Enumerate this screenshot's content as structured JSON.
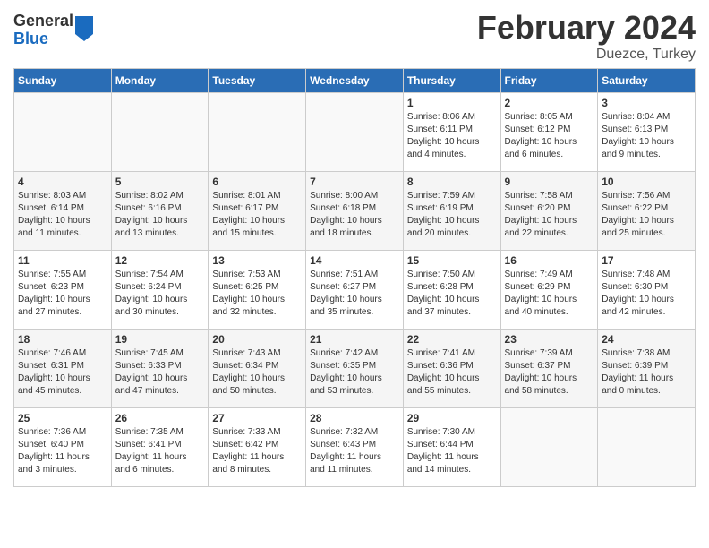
{
  "header": {
    "logo_general": "General",
    "logo_blue": "Blue",
    "month_title": "February 2024",
    "location": "Duezce, Turkey"
  },
  "weekdays": [
    "Sunday",
    "Monday",
    "Tuesday",
    "Wednesday",
    "Thursday",
    "Friday",
    "Saturday"
  ],
  "weeks": [
    [
      {
        "num": "",
        "info": ""
      },
      {
        "num": "",
        "info": ""
      },
      {
        "num": "",
        "info": ""
      },
      {
        "num": "",
        "info": ""
      },
      {
        "num": "1",
        "info": "Sunrise: 8:06 AM\nSunset: 6:11 PM\nDaylight: 10 hours\nand 4 minutes."
      },
      {
        "num": "2",
        "info": "Sunrise: 8:05 AM\nSunset: 6:12 PM\nDaylight: 10 hours\nand 6 minutes."
      },
      {
        "num": "3",
        "info": "Sunrise: 8:04 AM\nSunset: 6:13 PM\nDaylight: 10 hours\nand 9 minutes."
      }
    ],
    [
      {
        "num": "4",
        "info": "Sunrise: 8:03 AM\nSunset: 6:14 PM\nDaylight: 10 hours\nand 11 minutes."
      },
      {
        "num": "5",
        "info": "Sunrise: 8:02 AM\nSunset: 6:16 PM\nDaylight: 10 hours\nand 13 minutes."
      },
      {
        "num": "6",
        "info": "Sunrise: 8:01 AM\nSunset: 6:17 PM\nDaylight: 10 hours\nand 15 minutes."
      },
      {
        "num": "7",
        "info": "Sunrise: 8:00 AM\nSunset: 6:18 PM\nDaylight: 10 hours\nand 18 minutes."
      },
      {
        "num": "8",
        "info": "Sunrise: 7:59 AM\nSunset: 6:19 PM\nDaylight: 10 hours\nand 20 minutes."
      },
      {
        "num": "9",
        "info": "Sunrise: 7:58 AM\nSunset: 6:20 PM\nDaylight: 10 hours\nand 22 minutes."
      },
      {
        "num": "10",
        "info": "Sunrise: 7:56 AM\nSunset: 6:22 PM\nDaylight: 10 hours\nand 25 minutes."
      }
    ],
    [
      {
        "num": "11",
        "info": "Sunrise: 7:55 AM\nSunset: 6:23 PM\nDaylight: 10 hours\nand 27 minutes."
      },
      {
        "num": "12",
        "info": "Sunrise: 7:54 AM\nSunset: 6:24 PM\nDaylight: 10 hours\nand 30 minutes."
      },
      {
        "num": "13",
        "info": "Sunrise: 7:53 AM\nSunset: 6:25 PM\nDaylight: 10 hours\nand 32 minutes."
      },
      {
        "num": "14",
        "info": "Sunrise: 7:51 AM\nSunset: 6:27 PM\nDaylight: 10 hours\nand 35 minutes."
      },
      {
        "num": "15",
        "info": "Sunrise: 7:50 AM\nSunset: 6:28 PM\nDaylight: 10 hours\nand 37 minutes."
      },
      {
        "num": "16",
        "info": "Sunrise: 7:49 AM\nSunset: 6:29 PM\nDaylight: 10 hours\nand 40 minutes."
      },
      {
        "num": "17",
        "info": "Sunrise: 7:48 AM\nSunset: 6:30 PM\nDaylight: 10 hours\nand 42 minutes."
      }
    ],
    [
      {
        "num": "18",
        "info": "Sunrise: 7:46 AM\nSunset: 6:31 PM\nDaylight: 10 hours\nand 45 minutes."
      },
      {
        "num": "19",
        "info": "Sunrise: 7:45 AM\nSunset: 6:33 PM\nDaylight: 10 hours\nand 47 minutes."
      },
      {
        "num": "20",
        "info": "Sunrise: 7:43 AM\nSunset: 6:34 PM\nDaylight: 10 hours\nand 50 minutes."
      },
      {
        "num": "21",
        "info": "Sunrise: 7:42 AM\nSunset: 6:35 PM\nDaylight: 10 hours\nand 53 minutes."
      },
      {
        "num": "22",
        "info": "Sunrise: 7:41 AM\nSunset: 6:36 PM\nDaylight: 10 hours\nand 55 minutes."
      },
      {
        "num": "23",
        "info": "Sunrise: 7:39 AM\nSunset: 6:37 PM\nDaylight: 10 hours\nand 58 minutes."
      },
      {
        "num": "24",
        "info": "Sunrise: 7:38 AM\nSunset: 6:39 PM\nDaylight: 11 hours\nand 0 minutes."
      }
    ],
    [
      {
        "num": "25",
        "info": "Sunrise: 7:36 AM\nSunset: 6:40 PM\nDaylight: 11 hours\nand 3 minutes."
      },
      {
        "num": "26",
        "info": "Sunrise: 7:35 AM\nSunset: 6:41 PM\nDaylight: 11 hours\nand 6 minutes."
      },
      {
        "num": "27",
        "info": "Sunrise: 7:33 AM\nSunset: 6:42 PM\nDaylight: 11 hours\nand 8 minutes."
      },
      {
        "num": "28",
        "info": "Sunrise: 7:32 AM\nSunset: 6:43 PM\nDaylight: 11 hours\nand 11 minutes."
      },
      {
        "num": "29",
        "info": "Sunrise: 7:30 AM\nSunset: 6:44 PM\nDaylight: 11 hours\nand 14 minutes."
      },
      {
        "num": "",
        "info": ""
      },
      {
        "num": "",
        "info": ""
      }
    ]
  ]
}
